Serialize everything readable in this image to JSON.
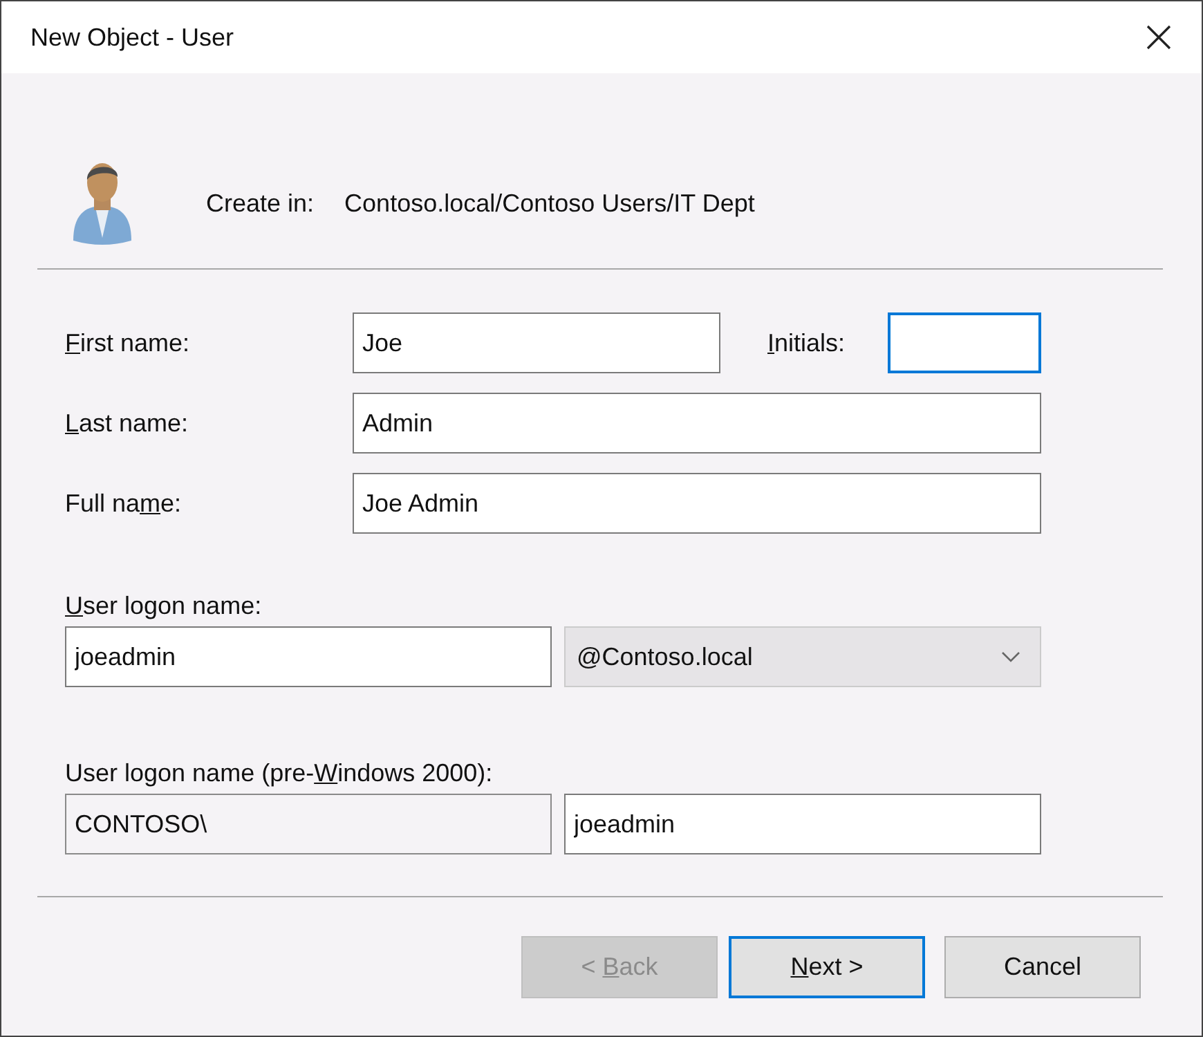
{
  "window": {
    "title": "New Object - User"
  },
  "header": {
    "label": "Create in:",
    "path": "Contoso.local/Contoso Users/IT Dept"
  },
  "first_name": {
    "label": {
      "key": "F",
      "post": "irst name:"
    },
    "value": "Joe",
    "focused": false
  },
  "initials": {
    "label": {
      "key": "I",
      "post": "nitials:"
    },
    "focused": true
  },
  "last_name": {
    "label": {
      "key": "L",
      "post": "ast name:"
    },
    "value": "Admin",
    "focused": false
  },
  "full_name": {
    "label": {
      "pre": "Full na",
      "key": "m",
      "post": "e:"
    },
    "value": "Joe Admin",
    "focused": false
  },
  "logon": {
    "label": {
      "key": "U",
      "post": "ser logon name:"
    },
    "value": "joeadmin",
    "domain": {
      "value": "@Contoso.local",
      "disabled": true
    }
  },
  "legacy": {
    "label": {
      "pre": "User logon name (pre-",
      "key": "W",
      "post": "indows 2000):"
    },
    "prefix": {
      "value": "CONTOSO\\",
      "read_only": true
    },
    "value": "joeadmin"
  },
  "buttons": [
    {
      "label": {
        "pre": "< ",
        "key": "B",
        "post": "ack"
      },
      "disabled": true,
      "default": false
    },
    {
      "label": {
        "key": "N",
        "post": "ext >"
      },
      "disabled": false,
      "default": true
    },
    {
      "label": {
        "pre": "Cancel"
      },
      "disabled": false,
      "default": false
    }
  ]
}
